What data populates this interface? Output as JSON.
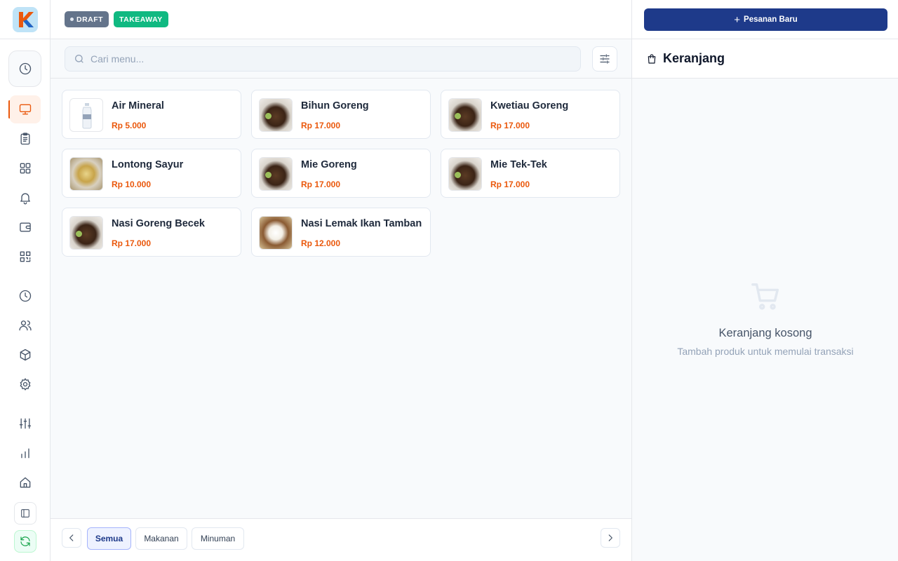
{
  "status_badges": {
    "draft": "DRAFT",
    "takeaway": "TAKEAWAY"
  },
  "search": {
    "placeholder": "Cari menu..."
  },
  "products": [
    {
      "name": "Air Mineral",
      "price": "Rp 5.000",
      "image": "water-bottle"
    },
    {
      "name": "Bihun Goreng",
      "price": "Rp 17.000",
      "image": "fried-noodle"
    },
    {
      "name": "Kwetiau Goreng",
      "price": "Rp 17.000",
      "image": "fried-noodle"
    },
    {
      "name": "Lontong Sayur",
      "price": "Rp 10.000",
      "image": "lontong"
    },
    {
      "name": "Mie Goreng",
      "price": "Rp 17.000",
      "image": "fried-noodle"
    },
    {
      "name": "Mie Tek-Tek",
      "price": "Rp 17.000",
      "image": "fried-noodle"
    },
    {
      "name": "Nasi Goreng Becek",
      "price": "Rp 17.000",
      "image": "fried-noodle"
    },
    {
      "name": "Nasi Lemak Ikan Tamban",
      "price": "Rp 12.000",
      "image": "nasi-lemak"
    }
  ],
  "categories": [
    {
      "label": "Semua",
      "active": true
    },
    {
      "label": "Makanan",
      "active": false
    },
    {
      "label": "Minuman",
      "active": false
    }
  ],
  "right_panel": {
    "new_order_label": "Pesanan Baru",
    "cart_title": "Keranjang",
    "empty_title": "Keranjang kosong",
    "empty_subtitle": "Tambah produk untuk memulai transaksi"
  },
  "sidebar": {
    "items": [
      {
        "icon": "clock-icon"
      },
      {
        "icon": "monitor-icon",
        "active": true
      },
      {
        "icon": "clipboard-icon"
      },
      {
        "icon": "grid-icon"
      },
      {
        "icon": "bell-icon"
      },
      {
        "icon": "wallet-icon"
      },
      {
        "icon": "qr-scan-icon"
      },
      {
        "icon": "clock-icon"
      },
      {
        "icon": "users-icon"
      },
      {
        "icon": "box-icon"
      },
      {
        "icon": "gear-icon"
      },
      {
        "icon": "sliders-icon"
      },
      {
        "icon": "bar-chart-icon"
      },
      {
        "icon": "home-icon"
      },
      {
        "icon": "panel-toggle-icon"
      },
      {
        "icon": "refresh-icon"
      }
    ]
  },
  "colors": {
    "accent": "#ea580c",
    "primary": "#1e3a8a",
    "draft_badge": "#64748b",
    "takeaway_badge": "#10b981"
  }
}
